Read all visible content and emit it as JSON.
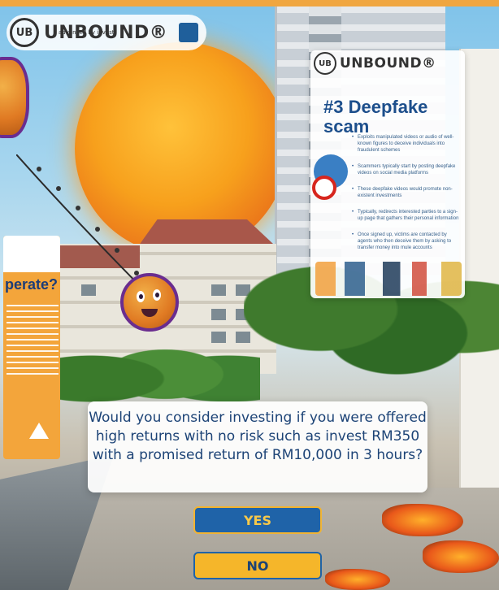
{
  "header": {
    "logo_mark": "UB",
    "logo_text": "UNBOUND®",
    "logo_sub": "advanced by invest"
  },
  "info_panel": {
    "logo_mark": "UB",
    "logo_text": "UNBOUND®",
    "title": "#3 Deepfake scam",
    "bullets": [
      "Exploits manipulated videos or audio of well-known figures to deceive individuals into fraudulent schemes",
      "Scammers typically start by posting deepfake videos on social media platforms",
      "These deepfake videos would promote non-existent investments",
      "Typically, redirects interested parties to a sign-up page that gathers their personal information",
      "Once signed up, victims are contacted by agents who then deceive them by asking to transfer money into mule accounts"
    ]
  },
  "left_panel": {
    "title": "perate?"
  },
  "question": {
    "text": "Would you consider investing if you were offered high returns with no risk such as invest RM350 with a promised return of RM10,000 in 3 hours?"
  },
  "answers": {
    "yes_label": "YES",
    "no_label": "NO"
  },
  "colors": {
    "brand_blue": "#1f63a8",
    "brand_yellow": "#f5b62a",
    "question_text": "#1c4376"
  }
}
